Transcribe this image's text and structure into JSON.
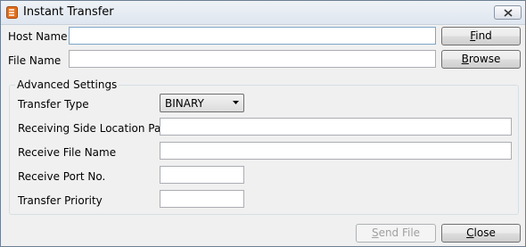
{
  "window": {
    "title": "Instant Transfer",
    "icon": "app-icon",
    "close_icon": "close-icon"
  },
  "host": {
    "label": "Host Name",
    "value": "",
    "button": "Find",
    "button_mnemonic": "F"
  },
  "file": {
    "label": "File Name",
    "value": "",
    "button": "Browse",
    "button_mnemonic": "B"
  },
  "advanced": {
    "legend": "Advanced Settings",
    "transfer_type": {
      "label": "Transfer Type",
      "selected": "BINARY"
    },
    "location_path": {
      "label": "Receiving Side Location Path",
      "value": ""
    },
    "receive_file_name": {
      "label": "Receive File Name",
      "value": ""
    },
    "receive_port": {
      "label": "Receive Port No.",
      "value": ""
    },
    "priority": {
      "label": "Transfer Priority",
      "value": ""
    }
  },
  "footer": {
    "send_label": "Send File",
    "send_mnemonic": "S",
    "close_label": "Close",
    "close_mnemonic": "C"
  },
  "colors": {
    "app_icon": "#e07020",
    "focus_border": "#7aa6c9"
  }
}
